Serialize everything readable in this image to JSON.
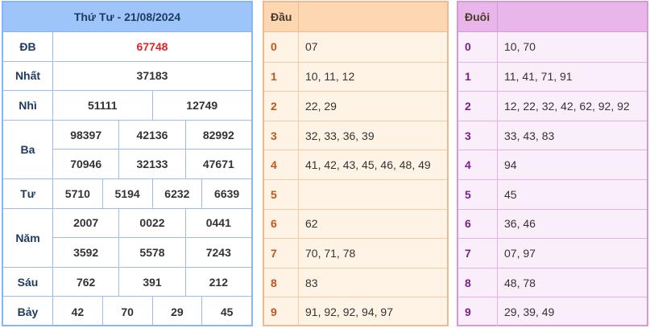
{
  "results": {
    "title": "Thứ Tư - 21/08/2024",
    "prizes": [
      {
        "label": "ĐB",
        "lines": [
          [
            "67748"
          ]
        ],
        "special": true
      },
      {
        "label": "Nhất",
        "lines": [
          [
            "37183"
          ]
        ]
      },
      {
        "label": "Nhì",
        "lines": [
          [
            "51111",
            "12749"
          ]
        ]
      },
      {
        "label": "Ba",
        "lines": [
          [
            "98397",
            "42136",
            "82992"
          ],
          [
            "70946",
            "32133",
            "47671"
          ]
        ]
      },
      {
        "label": "Tư",
        "lines": [
          [
            "5710",
            "5194",
            "6232",
            "6639"
          ]
        ]
      },
      {
        "label": "Năm",
        "lines": [
          [
            "2007",
            "0022",
            "0441"
          ],
          [
            "3592",
            "5578",
            "7243"
          ]
        ]
      },
      {
        "label": "Sáu",
        "lines": [
          [
            "762",
            "391",
            "212"
          ]
        ]
      },
      {
        "label": "Bảy",
        "lines": [
          [
            "42",
            "70",
            "29",
            "45"
          ]
        ]
      }
    ]
  },
  "head_table": {
    "title": "Đầu",
    "rows": [
      {
        "key": "0",
        "value": "07"
      },
      {
        "key": "1",
        "value": "10, 11, 12"
      },
      {
        "key": "2",
        "value": "22, 29"
      },
      {
        "key": "3",
        "value": "32, 33, 36, 39"
      },
      {
        "key": "4",
        "value": "41, 42, 43, 45, 46, 48, 49"
      },
      {
        "key": "5",
        "value": ""
      },
      {
        "key": "6",
        "value": "62"
      },
      {
        "key": "7",
        "value": "70, 71, 78"
      },
      {
        "key": "8",
        "value": "83"
      },
      {
        "key": "9",
        "value": "91, 92, 92, 94, 97"
      }
    ]
  },
  "tail_table": {
    "title": "Đuôi",
    "rows": [
      {
        "key": "0",
        "value": "10, 70"
      },
      {
        "key": "1",
        "value": "11, 41, 71, 91"
      },
      {
        "key": "2",
        "value": "12, 22, 32, 42, 62, 92, 92"
      },
      {
        "key": "3",
        "value": "33, 43, 83"
      },
      {
        "key": "4",
        "value": "94"
      },
      {
        "key": "5",
        "value": "45"
      },
      {
        "key": "6",
        "value": "36, 46"
      },
      {
        "key": "7",
        "value": "07, 97"
      },
      {
        "key": "8",
        "value": "48, 78"
      },
      {
        "key": "9",
        "value": "29, 39, 49"
      }
    ]
  },
  "colors": {
    "special_prize": "#e02424",
    "results_header": "#9ec5fa",
    "head_header": "#fdd6b2",
    "tail_header": "#e9b6e9"
  }
}
